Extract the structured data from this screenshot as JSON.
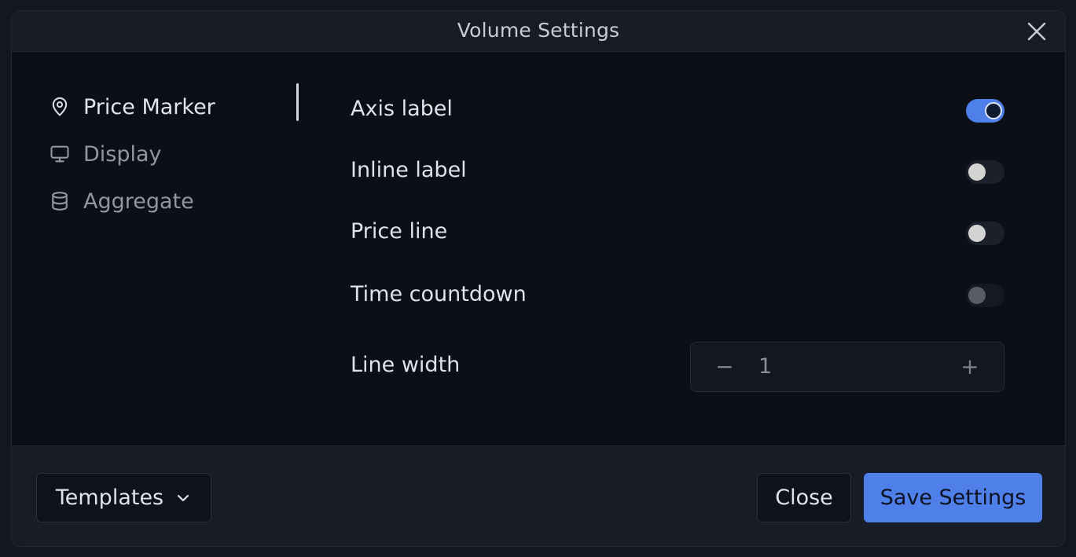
{
  "dialog": {
    "title": "Volume Settings"
  },
  "sidebar": {
    "items": [
      {
        "label": "Price Marker",
        "icon": "map-pin-icon",
        "active": true
      },
      {
        "label": "Display",
        "icon": "monitor-icon",
        "active": false
      },
      {
        "label": "Aggregate",
        "icon": "database-icon",
        "active": false
      }
    ]
  },
  "settings": {
    "axis_label": {
      "label": "Axis label",
      "enabled": true
    },
    "inline_label": {
      "label": "Inline label",
      "enabled": false
    },
    "price_line": {
      "label": "Price line",
      "enabled": false
    },
    "time_countdown": {
      "label": "Time countdown",
      "enabled": false,
      "disabled": true
    },
    "line_width": {
      "label": "Line width",
      "value": "1",
      "minus": "−",
      "plus": "+"
    }
  },
  "footer": {
    "templates_label": "Templates",
    "close_label": "Close",
    "save_label": "Save Settings"
  },
  "colors": {
    "accent": "#4f7fe8",
    "background": "#0c0f16",
    "header": "#181c26"
  }
}
